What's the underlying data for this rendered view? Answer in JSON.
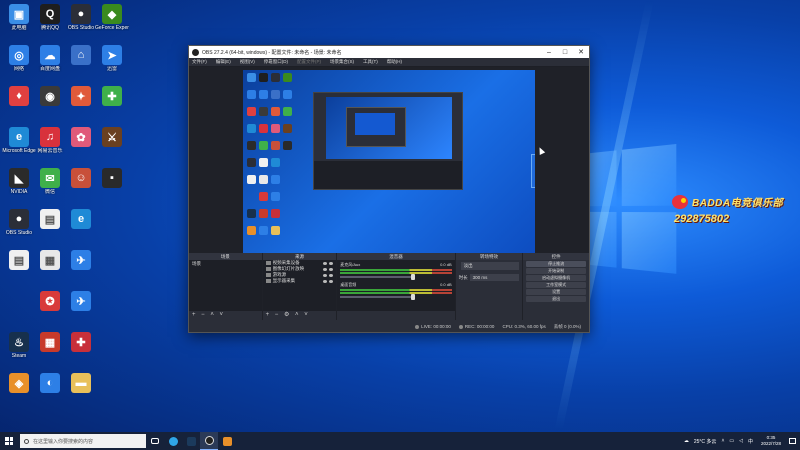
{
  "colors": {
    "accent": "#1a6fe6",
    "obs_panel": "#2b2e38",
    "obs_dark": "#1d1f26",
    "watermark_text": "#ffe36b",
    "taskbar": "#16223a"
  },
  "desktop_icons": [
    {
      "label": "此电脑",
      "color": "#3a8ee6",
      "glyph": "▣",
      "icon": "computer-icon",
      "col": 0,
      "row": 0
    },
    {
      "label": "腾讯QQ",
      "color": "#1e1e1e",
      "glyph": "Q",
      "icon": "qq-icon",
      "col": 1,
      "row": 0
    },
    {
      "label": "OBS Studio",
      "color": "#2b2e38",
      "glyph": "●",
      "icon": "obs-icon",
      "col": 2,
      "row": 0
    },
    {
      "label": "GeForce Experience",
      "color": "#3a8a1e",
      "glyph": "◆",
      "icon": "nvidia-icon",
      "col": 3,
      "row": 0
    },
    {
      "label": "网络",
      "color": "#2d7fe6",
      "glyph": "◎",
      "icon": "network-icon",
      "col": 0,
      "row": 1
    },
    {
      "label": "百度网盘",
      "color": "#2d7fe6",
      "glyph": "☁",
      "icon": "cloud-icon",
      "col": 1,
      "row": 1
    },
    {
      "label": "",
      "color": "#3a70c8",
      "glyph": "⌂",
      "icon": "app-icon",
      "col": 2,
      "row": 1
    },
    {
      "label": "迅雷",
      "color": "#2d7fe6",
      "glyph": "➤",
      "icon": "thunder-icon",
      "col": 3,
      "row": 1
    },
    {
      "label": "",
      "color": "#e04040",
      "glyph": "♦",
      "icon": "app-icon",
      "col": 0,
      "row": 2
    },
    {
      "label": "",
      "color": "#3a3a3a",
      "glyph": "◉",
      "icon": "app-icon",
      "col": 1,
      "row": 2
    },
    {
      "label": "",
      "color": "#e05a3a",
      "glyph": "✦",
      "icon": "app-icon",
      "col": 2,
      "row": 2
    },
    {
      "label": "",
      "color": "#3fb04a",
      "glyph": "✚",
      "icon": "app-icon",
      "col": 3,
      "row": 2
    },
    {
      "label": "Microsoft Edge",
      "color": "#1f8ad6",
      "glyph": "e",
      "icon": "edge-icon",
      "col": 0,
      "row": 3
    },
    {
      "label": "网易云音乐",
      "color": "#d8323c",
      "glyph": "♫",
      "icon": "music-icon",
      "col": 1,
      "row": 3
    },
    {
      "label": "",
      "color": "#e05a7a",
      "glyph": "✿",
      "icon": "app-icon",
      "col": 2,
      "row": 3
    },
    {
      "label": "",
      "color": "#6a4020",
      "glyph": "⚔",
      "icon": "game-icon",
      "col": 3,
      "row": 3
    },
    {
      "label": "NVIDIA",
      "color": "#2b2b2b",
      "glyph": "◣",
      "icon": "app-icon",
      "col": 0,
      "row": 4
    },
    {
      "label": "微信",
      "color": "#3fb04a",
      "glyph": "✉",
      "icon": "wechat-icon",
      "col": 1,
      "row": 4
    },
    {
      "label": "",
      "color": "#c8503a",
      "glyph": "☺",
      "icon": "game-icon",
      "col": 2,
      "row": 4
    },
    {
      "label": "",
      "color": "#2a2a2a",
      "glyph": "▪",
      "icon": "app-icon",
      "col": 3,
      "row": 4
    },
    {
      "label": "OBS Studio",
      "color": "#2b2e38",
      "glyph": "●",
      "icon": "obs-icon",
      "col": 0,
      "row": 5
    },
    {
      "label": "",
      "color": "#f0f0f0",
      "glyph": "▤",
      "icon": "file-icon",
      "col": 1,
      "row": 5
    },
    {
      "label": "",
      "color": "#1f8ad6",
      "glyph": "e",
      "icon": "ie-icon",
      "col": 2,
      "row": 5
    },
    {
      "label": "",
      "color": "#f0f0f0",
      "glyph": "▤",
      "icon": "file-icon",
      "col": 0,
      "row": 6
    },
    {
      "label": "",
      "color": "#e8e8e8",
      "glyph": "▦",
      "icon": "app-icon",
      "col": 1,
      "row": 6
    },
    {
      "label": "",
      "color": "#2d7fe6",
      "glyph": "✈",
      "icon": "app-icon",
      "col": 2,
      "row": 6
    },
    {
      "label": "",
      "color": "#d83a3a",
      "glyph": "✪",
      "icon": "app-icon",
      "col": 1,
      "row": 7
    },
    {
      "label": "",
      "color": "#2d7fe6",
      "glyph": "✈",
      "icon": "app-icon",
      "col": 2,
      "row": 7
    },
    {
      "label": "Steam",
      "color": "#17304d",
      "glyph": "♨",
      "icon": "steam-icon",
      "col": 0,
      "row": 8
    },
    {
      "label": "",
      "color": "#c83a2a",
      "glyph": "▦",
      "icon": "app-icon",
      "col": 1,
      "row": 8
    },
    {
      "label": "",
      "color": "#c8303a",
      "glyph": "✚",
      "icon": "app-icon",
      "col": 2,
      "row": 8
    },
    {
      "label": "",
      "color": "#e8902a",
      "glyph": "◈",
      "icon": "app-icon",
      "col": 0,
      "row": 9
    },
    {
      "label": "",
      "color": "#2d7fe6",
      "glyph": "◐",
      "icon": "app-icon",
      "col": 1,
      "row": 9
    },
    {
      "label": "",
      "color": "#e8c05a",
      "glyph": "▬",
      "icon": "folder-icon",
      "col": 2,
      "row": 9
    }
  ],
  "watermark": {
    "name": "BADDA电竞俱乐部",
    "number": "292875802"
  },
  "obs": {
    "title": "OBS 27.2.4 (64-bit, windows) - 配置文件: 未命名 - 场景: 未命名",
    "menu": [
      "文件(F)",
      "编辑(E)",
      "视图(V)",
      "停靠窗口(D)",
      "配置文件(P)",
      "场景集合(S)",
      "工具(T)",
      "帮助(H)"
    ],
    "no_source": "未选择源",
    "properties_btn": "属性",
    "filters_btn": "滤镜",
    "docks": {
      "scenes": "场景",
      "sources": "来源",
      "mixer": "混音器",
      "transitions": "转场特效",
      "controls": "控件"
    },
    "scene_items": [
      "场景"
    ],
    "source_items": [
      "视频采集设备",
      "图像幻灯片放映",
      "游戏源",
      "显示器采集"
    ],
    "mixer_items": [
      {
        "name": "麦克风/Aux",
        "db": "0.0 dB"
      },
      {
        "name": "桌面音频",
        "db": "0.0 dB"
      }
    ],
    "transition_type": "淡出",
    "duration_label": "时长",
    "duration_value": "300 ms",
    "controls": [
      "停止推流",
      "开始录制",
      "启动虚拟摄像机",
      "工作室模式",
      "设置",
      "退出"
    ],
    "status": {
      "live": "LIVE: 00:00:00",
      "rec": "REC: 00:00:00",
      "cpu": "CPU: 0.3%, 60.00 fps",
      "dropped": "丢帧 0 (0.0%)"
    }
  },
  "taskbar": {
    "search_placeholder": "在这里输入你要搜索的内容",
    "weather": "25°C 多云",
    "time": "0:35",
    "date": "2022/7/28"
  }
}
